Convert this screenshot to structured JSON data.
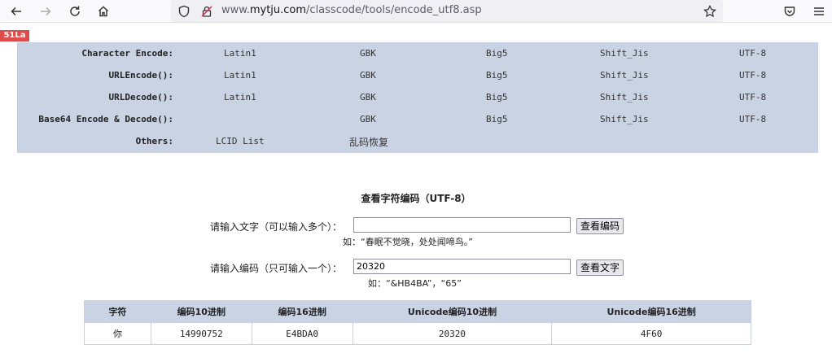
{
  "browser": {
    "url_prefix": "www.",
    "url_domain": "mytju.com",
    "url_path": "/classcode/tools/encode_utf8.asp"
  },
  "badge": "51La",
  "nav": {
    "rows": [
      {
        "label": "Character Encode:",
        "links": [
          "Latin1",
          "GBK",
          "Big5",
          "Shift_Jis",
          "UTF-8"
        ]
      },
      {
        "label": "URLEncode():",
        "links": [
          "Latin1",
          "GBK",
          "Big5",
          "Shift_Jis",
          "UTF-8"
        ]
      },
      {
        "label": "URLDecode():",
        "links": [
          "Latin1",
          "GBK",
          "Big5",
          "Shift_Jis",
          "UTF-8"
        ]
      },
      {
        "label": "Base64 Encode & Decode():",
        "links": [
          "GBK",
          "Big5",
          "Shift_Jis",
          "UTF-8"
        ]
      },
      {
        "label": "Others:",
        "links": [
          "LCID List",
          "乱码恢复"
        ]
      }
    ]
  },
  "main": {
    "title": "查看字符编码（UTF-8）",
    "text_label": "请输入文字（可以输入多个）：",
    "text_value": "",
    "text_button": "查看编码",
    "text_hint": "如：“春眠不觉晓，处处闻啼鸟。”",
    "code_label": "请输入编码（只可输入一个）：",
    "code_value": "20320",
    "code_button": "查看文字",
    "code_hint": "如：“&HB4BA”，“65”"
  },
  "table": {
    "headers": [
      "字符",
      "编码10进制",
      "编码16进制",
      "Unicode编码10进制",
      "Unicode编码16进制"
    ],
    "row": [
      "你",
      "14990752",
      "E4BDA0",
      "20320",
      "4F60"
    ]
  }
}
